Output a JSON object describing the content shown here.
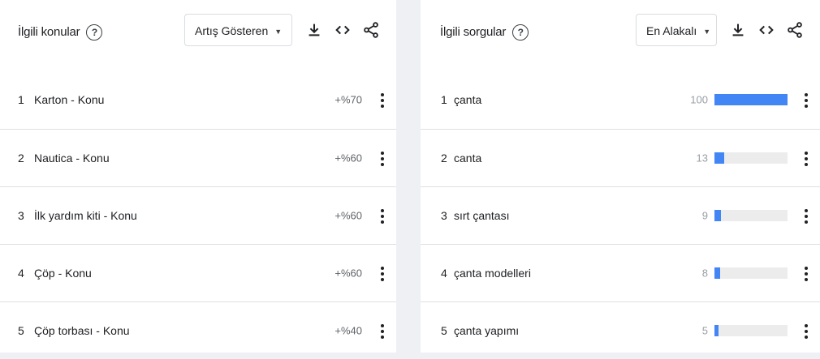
{
  "related_topics": {
    "title": "İlgili konular",
    "help": "?",
    "dropdown": "Artış Gösteren",
    "items": [
      {
        "rank": "1",
        "label": "Karton - Konu",
        "value": "+%70"
      },
      {
        "rank": "2",
        "label": "Nautica - Konu",
        "value": "+%60"
      },
      {
        "rank": "3",
        "label": "İlk yardım kiti - Konu",
        "value": "+%60"
      },
      {
        "rank": "4",
        "label": "Çöp - Konu",
        "value": "+%60"
      },
      {
        "rank": "5",
        "label": "Çöp torbası - Konu",
        "value": "+%40"
      }
    ]
  },
  "related_queries": {
    "title": "İlgili sorgular",
    "help": "?",
    "dropdown": "En Alakalı",
    "items": [
      {
        "rank": "1",
        "label": "çanta",
        "value": "100",
        "fraction": 1.0
      },
      {
        "rank": "2",
        "label": "canta",
        "value": "13",
        "fraction": 0.13
      },
      {
        "rank": "3",
        "label": "sırt çantası",
        "value": "9",
        "fraction": 0.09
      },
      {
        "rank": "4",
        "label": "çanta modelleri",
        "value": "8",
        "fraction": 0.08
      },
      {
        "rank": "5",
        "label": "çanta yapımı",
        "value": "5",
        "fraction": 0.05
      }
    ]
  },
  "colors": {
    "bar": "#4285f4",
    "track": "#ececec"
  },
  "icons": [
    "help-icon",
    "dropdown-caret-icon",
    "download-icon",
    "embed-icon",
    "share-icon",
    "more-vert-icon"
  ]
}
